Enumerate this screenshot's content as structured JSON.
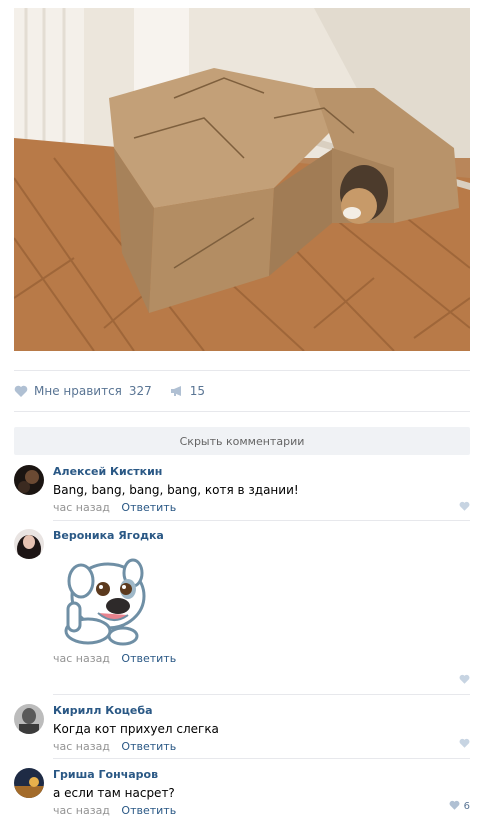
{
  "post": {
    "like_label": "Мне нравится",
    "like_count": "327",
    "share_count": "15"
  },
  "comments_toggle": "Скрыть комментарии",
  "comments": [
    {
      "author": "Алексей Кисткин",
      "text": "Bang, bang, bang, bang, котя в здании!",
      "time": "час назад",
      "reply": "Ответить",
      "likes": ""
    },
    {
      "author": "Вероника Ягодка",
      "text": "",
      "time": "час назад",
      "reply": "Ответить",
      "likes": ""
    },
    {
      "author": "Кирилл Коцеба",
      "text": "Когда кот прихуел слегка",
      "time": "час назад",
      "reply": "Ответить",
      "likes": ""
    },
    {
      "author": "Гриша Гончаров",
      "text": "а если там насрет?",
      "time": "час назад",
      "reply": "Ответить",
      "likes": "6"
    }
  ],
  "colors": {
    "link": "#2a5885",
    "meta": "#939393",
    "action": "#5a7594",
    "separator": "#e7e8ec",
    "button_bg": "#f0f2f5"
  },
  "icons": [
    "heart-icon",
    "megaphone-icon",
    "sticker-dog"
  ]
}
